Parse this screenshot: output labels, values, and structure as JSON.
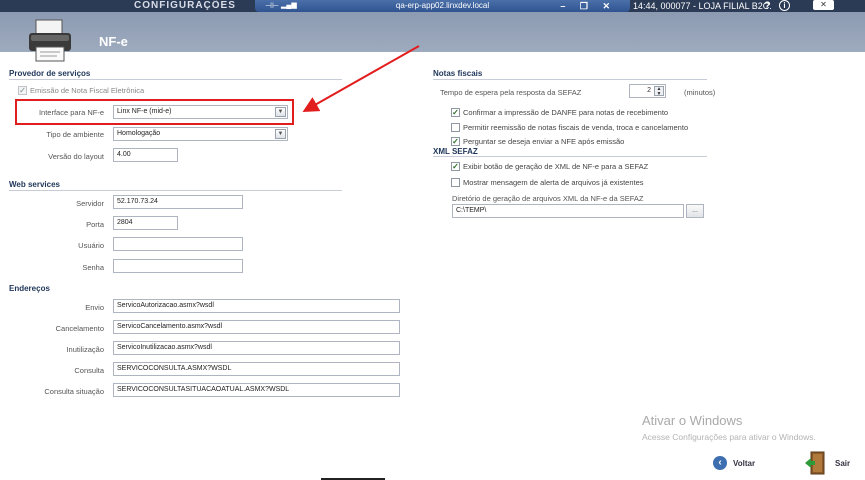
{
  "topbar": {
    "app_title": "CONFIGURAÇÕES",
    "remote_host": "qa-erp-app02.linxdev.local",
    "status": "14:44, 000077 - LOJA FILIAL B2C.",
    "help": "?",
    "info": "i",
    "close": "✕",
    "pin_icon": "pin-icon",
    "signal_icon": "signal-icon",
    "window_controls": "– ❐ ✕"
  },
  "header": {
    "title": "NF-e",
    "icon": "printer-icon"
  },
  "provedor": {
    "title": "Provedor de serviços",
    "emissao_label": "Emissão de Nota Fiscal Eletrônica",
    "emissao_checked": true,
    "interface_label": "Interface para NF-e",
    "interface_value": "Linx NF-e (mid-e)",
    "ambiente_label": "Tipo de ambiente",
    "ambiente_value": "Homologação",
    "versao_label": "Versão do layout",
    "versao_value": "4.00"
  },
  "webservices": {
    "title": "Web services",
    "servidor_label": "Servidor",
    "servidor_value": "52.170.73.24",
    "porta_label": "Porta",
    "porta_value": "2804",
    "usuario_label": "Usuário",
    "usuario_value": "",
    "senha_label": "Senha",
    "senha_value": ""
  },
  "enderecos": {
    "title": "Endereços",
    "rows": [
      {
        "label": "Envio",
        "value": "ServicoAutorizacao.asmx?wsdl"
      },
      {
        "label": "Cancelamento",
        "value": "ServicoCancelamento.asmx?wsdl"
      },
      {
        "label": "Inutilização",
        "value": "ServicoInutilizacao.asmx?wsdl"
      },
      {
        "label": "Consulta",
        "value": "SERVICOCONSULTA.ASMX?WSDL"
      },
      {
        "label": "Consulta situação",
        "value": "SERVICOCONSULTASITUACAOATUAL.ASMX?WSDL"
      }
    ]
  },
  "notas": {
    "title": "Notas fiscais",
    "espera_label": "Tempo de espera pela resposta da SEFAZ",
    "espera_value": "2",
    "espera_unit": "(minutos)",
    "confirmar_label": "Confirmar a impressão de DANFE para notas de recebimento",
    "permitir_label": "Permitir reemissão de notas fiscais de venda, troca e cancelamento",
    "perguntar_label": "Perguntar se deseja enviar a NFE após emissão"
  },
  "xml": {
    "title": "XML SEFAZ",
    "exibir_label": "Exibir botão de geração de XML de NF-e para a SEFAZ",
    "mostrar_label": "Mostrar mensagem de alerta de arquivos já existentes",
    "diretorio_label": "Diretório de geração de arquivos XML da NF-e da SEFAZ",
    "diretorio_value": "C:\\TEMP\\",
    "browse_label": "..."
  },
  "watermark": {
    "title": "Ativar o Windows",
    "subtitle": "Acesse Configurações para ativar o Windows."
  },
  "footer": {
    "voltar": "Voltar",
    "sair": "Sair"
  },
  "colors": {
    "highlight": "#e21d1d",
    "header": "#9aa8bd",
    "topbar": "#2b3a55"
  }
}
